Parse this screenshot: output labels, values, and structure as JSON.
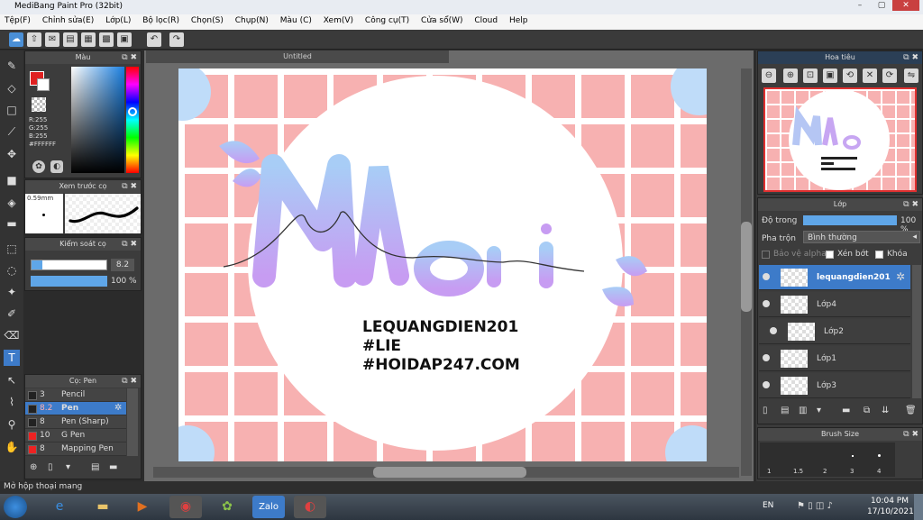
{
  "window": {
    "title": "MediBang Paint Pro (32bit)"
  },
  "menu": [
    "Tệp(F)",
    "Chỉnh sửa(E)",
    "Lớp(L)",
    "Bộ lọc(R)",
    "Chọn(S)",
    "Chụp(N)",
    "Màu (C)",
    "Xem(V)",
    "Công cụ(T)",
    "Cửa sổ(W)",
    "Cloud",
    "Help"
  ],
  "color_panel": {
    "title": "Màu",
    "r": "R:255",
    "g": "G:255",
    "b": "B:255",
    "hex": "#FFFFFF"
  },
  "brush_preview": {
    "title": "Xem trước cọ",
    "size": "0.59mm"
  },
  "brush_control": {
    "title": "Kiểm soát cọ",
    "size": "8.2",
    "opacity": "100 %"
  },
  "brush_list": {
    "title": "Cọ: Pen",
    "items": [
      {
        "size": "3",
        "name": "Pencil",
        "color": "#222222"
      },
      {
        "size": "8.2",
        "name": "Pen",
        "color": "#222222",
        "selected": true
      },
      {
        "size": "8",
        "name": "Pen (Sharp)",
        "color": "#222222"
      },
      {
        "size": "10",
        "name": "G Pen",
        "color": "#ee2222"
      },
      {
        "size": "8",
        "name": "Mapping Pen",
        "color": "#ee2222"
      }
    ]
  },
  "canvas": {
    "tab_title": "Untitled",
    "watermark_lines": [
      "LEQUANGDIEN201",
      "#LIE",
      "#HOIDAP247.COM"
    ],
    "name_art": "Mai"
  },
  "navigator": {
    "title": "Hoa tiêu"
  },
  "layer_panel": {
    "title": "Lớp",
    "opacity_label": "Độ trong",
    "opacity_value": "100 %",
    "opacity_fraction": 1.0,
    "blend_label": "Pha trộn",
    "blend_value": "Bình thường",
    "protect_alpha": "Bảo vệ alpha",
    "clipping": "Xén bớt",
    "lock": "Khóa",
    "layers": [
      {
        "name": "lequangdien201",
        "selected": true
      },
      {
        "name": "Lớp4"
      },
      {
        "name": "Lớp2"
      },
      {
        "name": "Lớp1"
      },
      {
        "name": "Lớp3"
      }
    ]
  },
  "brush_size_panel": {
    "title": "Brush Size",
    "sizes": [
      "1",
      "1.5",
      "2",
      "3",
      "4"
    ]
  },
  "status": {
    "text": "Mở hộp thoại mang"
  },
  "taskbar": {
    "lang": "EN",
    "time": "10:04 PM",
    "date": "17/10/2021"
  }
}
